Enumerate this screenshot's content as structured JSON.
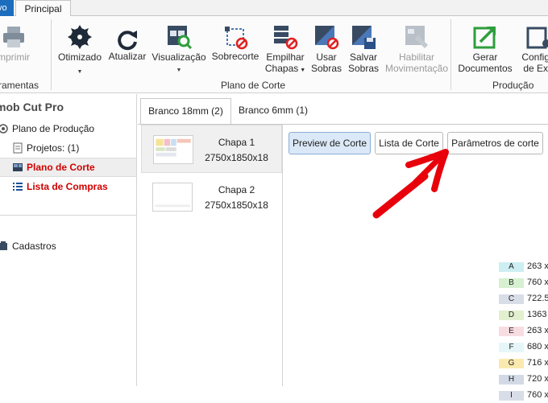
{
  "ribbon": {
    "file_tab": "vo",
    "home_tab": "Principal",
    "buttons": {
      "imprimir": "mprimir",
      "otimizado": "Otimizado",
      "atualizar": "Atualizar",
      "visualizacao": "Visualização",
      "sobrecorte": "Sobrecorte",
      "empilhar_1": "Empilhar",
      "empilhar_2": "Chapas",
      "usar_sobras_1": "Usar",
      "usar_sobras_2": "Sobras",
      "salvar_sobras_1": "Salvar",
      "salvar_sobras_2": "Sobras",
      "habilitar_1": "Habilitar",
      "habilitar_2": "Movimentação",
      "gerar_1": "Gerar",
      "gerar_2": "Documentos",
      "config_1": "Configu",
      "config_2": "de Exp"
    },
    "groups": {
      "ferramentas": "ramentas",
      "plano_de_corte": "Plano de Corte",
      "producao": "Produção"
    }
  },
  "sidebar": {
    "title": "mob Cut Pro",
    "items": [
      {
        "label": "Plano de Produção"
      },
      {
        "label": "Projetos: (1)"
      },
      {
        "label": "Plano de Corte"
      },
      {
        "label": "Lista de Compras"
      },
      {
        "label": "Cadastros"
      }
    ]
  },
  "main": {
    "tabs": [
      {
        "label": "Branco 18mm (2)"
      },
      {
        "label": "Branco 6mm (1)"
      }
    ],
    "sheets": [
      {
        "name": "Chapa 1",
        "dims": "2750x1850x18"
      },
      {
        "name": "Chapa 2",
        "dims": "2750x1850x18"
      }
    ],
    "view_buttons": {
      "preview": "Preview de Corte",
      "lista": "Lista de Corte",
      "parametros": "Parâmetros de corte"
    },
    "legend": [
      {
        "key": "A",
        "value": "263 x",
        "color": "#cdeef3"
      },
      {
        "key": "B",
        "value": "760 x",
        "color": "#d6f0d0"
      },
      {
        "key": "C",
        "value": "722.5",
        "color": "#d8dde8"
      },
      {
        "key": "D",
        "value": "1363",
        "color": "#e2f0cf"
      },
      {
        "key": "E",
        "value": "263 x",
        "color": "#f7dde2"
      },
      {
        "key": "F",
        "value": "680 x",
        "color": "#e6f6f8"
      },
      {
        "key": "G",
        "value": "716 x",
        "color": "#fbeab0"
      },
      {
        "key": "H",
        "value": "720 x",
        "color": "#d3dae6"
      },
      {
        "key": "I",
        "value": "760 x",
        "color": "#d8dde8"
      }
    ]
  },
  "colors": {
    "accent_blue": "#1c6dbd",
    "red_text": "#d00000",
    "annotation_arrow": "#e8000b"
  }
}
